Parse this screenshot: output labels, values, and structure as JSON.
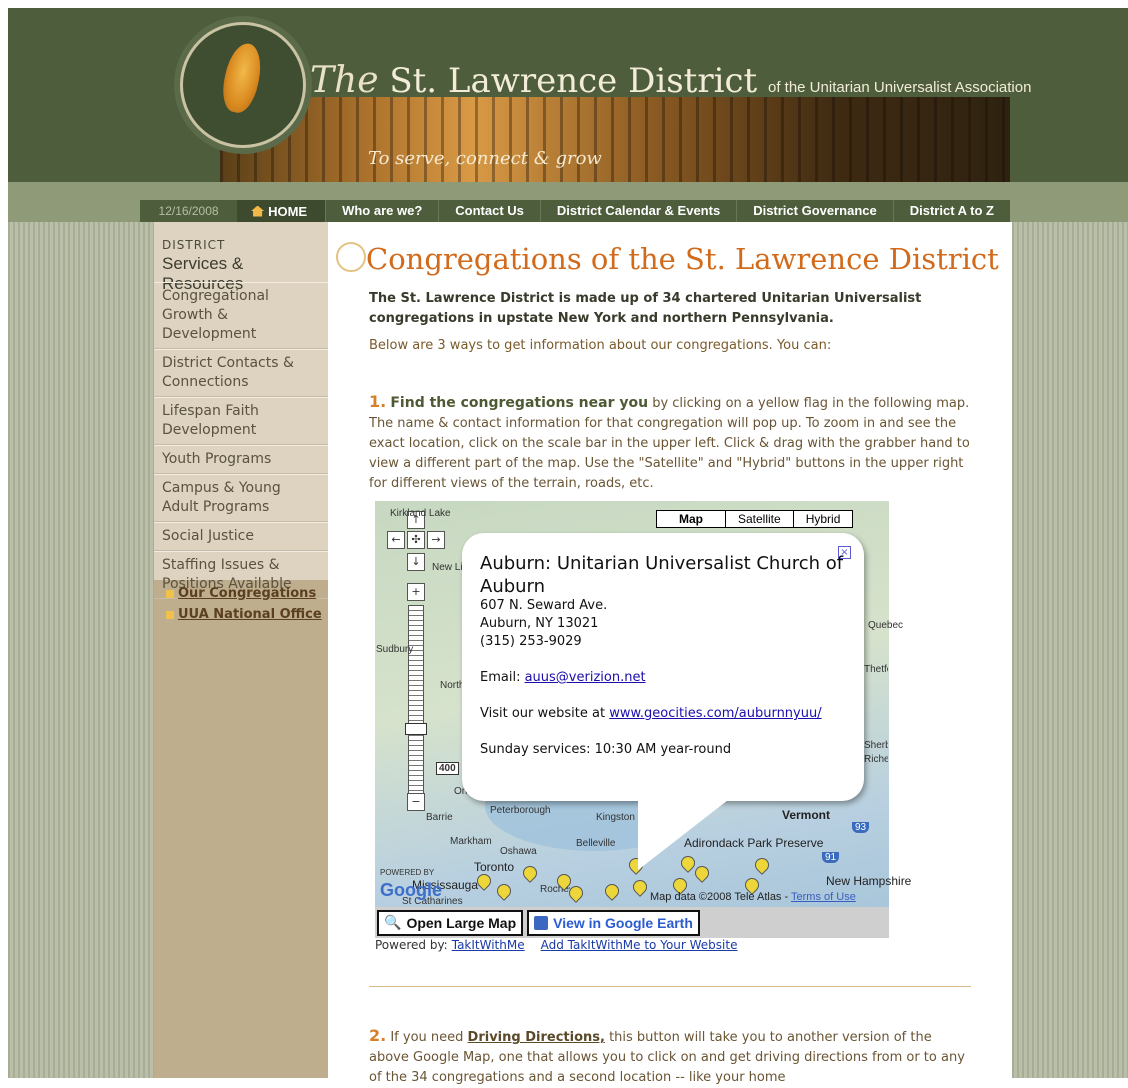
{
  "header": {
    "title_the": "The",
    "title_main": "St. Lawrence District",
    "title_sub": "of the Unitarian Universalist Association",
    "tagline": "To serve, connect & grow"
  },
  "nav": {
    "date": "12/16/2008",
    "home": "HOME",
    "items": [
      "Who are we?",
      "Contact Us",
      "District Calendar & Events",
      "District Governance",
      "District A to Z"
    ]
  },
  "sidebar": {
    "heading_small": "DISTRICT",
    "heading_large": "Services & Resources",
    "items": [
      "Congregational Growth & Development",
      "District Contacts & Connections",
      "Lifespan Faith Development",
      "Youth Programs",
      "Campus & Young Adult Programs",
      "Social Justice",
      "Staffing Issues & Positions Available"
    ],
    "links": [
      "Our Congregations",
      "UUA National Office"
    ]
  },
  "main": {
    "page_title": "Congregations of the St. Lawrence District",
    "intro_bold": "The St. Lawrence District is made up of 34 chartered Unitarian Universalist congregations in upstate New York and northern Pennsylvania.",
    "intro_plain": "Below are 3 ways to get information about our congregations. You can:",
    "step1_num": "1.",
    "step1_lead": "Find the congregations near you",
    "step1_text": " by clicking on a yellow flag in the following map. The name & contact information for that congregation will pop up. To zoom in and see the exact location, click on the scale bar in the upper left. Click & drag with the grabber hand to view a different part of the map. Use the \"Satellite\" and \"Hybrid\" buttons in the upper right for different views of the terrain, roads, etc.",
    "step2_num": "2.",
    "step2_pre": " If you need ",
    "step2_lead": "Driving Directions,",
    "step2_text": " this button will take you to another version of the above Google Map, one that allows you to click on and get driving directions from or to any of the 34 congregations and a second location -- like your home"
  },
  "map": {
    "type_buttons": [
      "Map",
      "Satellite",
      "Hybrid"
    ],
    "info": {
      "title": "Auburn: Unitarian Universalist Church of Auburn",
      "address1": "607 N. Seward Ave.",
      "address2": "Auburn, NY 13021",
      "phone": "(315) 253-9029",
      "email_label": "Email: ",
      "email": "auus@verizion.net",
      "website_label": "Visit our website at ",
      "website": "www.geocities.com/auburnnyuu/",
      "services": "Sunday services: 10:30 AM year-round"
    },
    "places": [
      "Peterborough",
      "Kingston",
      "Vermont",
      "Barrie",
      "Markham",
      "Oshawa",
      "Belleville",
      "Adirondack Park Preserve",
      "Toronto",
      "Mississauga",
      "St Catharines",
      "Rochester",
      "New Hampshire",
      "Orillia",
      "Sudbury",
      "North Bay",
      "Kirkland Lake",
      "New Liskeard",
      "Quebec",
      "Thetford Mines",
      "Sherbrooke",
      "Richelieu"
    ],
    "highway": "400",
    "interstates": [
      "93",
      "91"
    ],
    "powered_by_google": "POWERED BY",
    "google": "Google",
    "attribution": "Map data ©2008 Tele Atlas - ",
    "terms": "Terms of Use",
    "btn_large": "Open Large Map",
    "btn_earth": "View in Google Earth",
    "powered_label": "Powered by:",
    "powered_link": "TakItWithMe",
    "add_link": "Add TakItWithMe to Your Website"
  },
  "colors": {
    "header_green": "#4e5d3c",
    "accent_orange": "#d26a1b",
    "sidebar_tan": "#bfae8d"
  }
}
